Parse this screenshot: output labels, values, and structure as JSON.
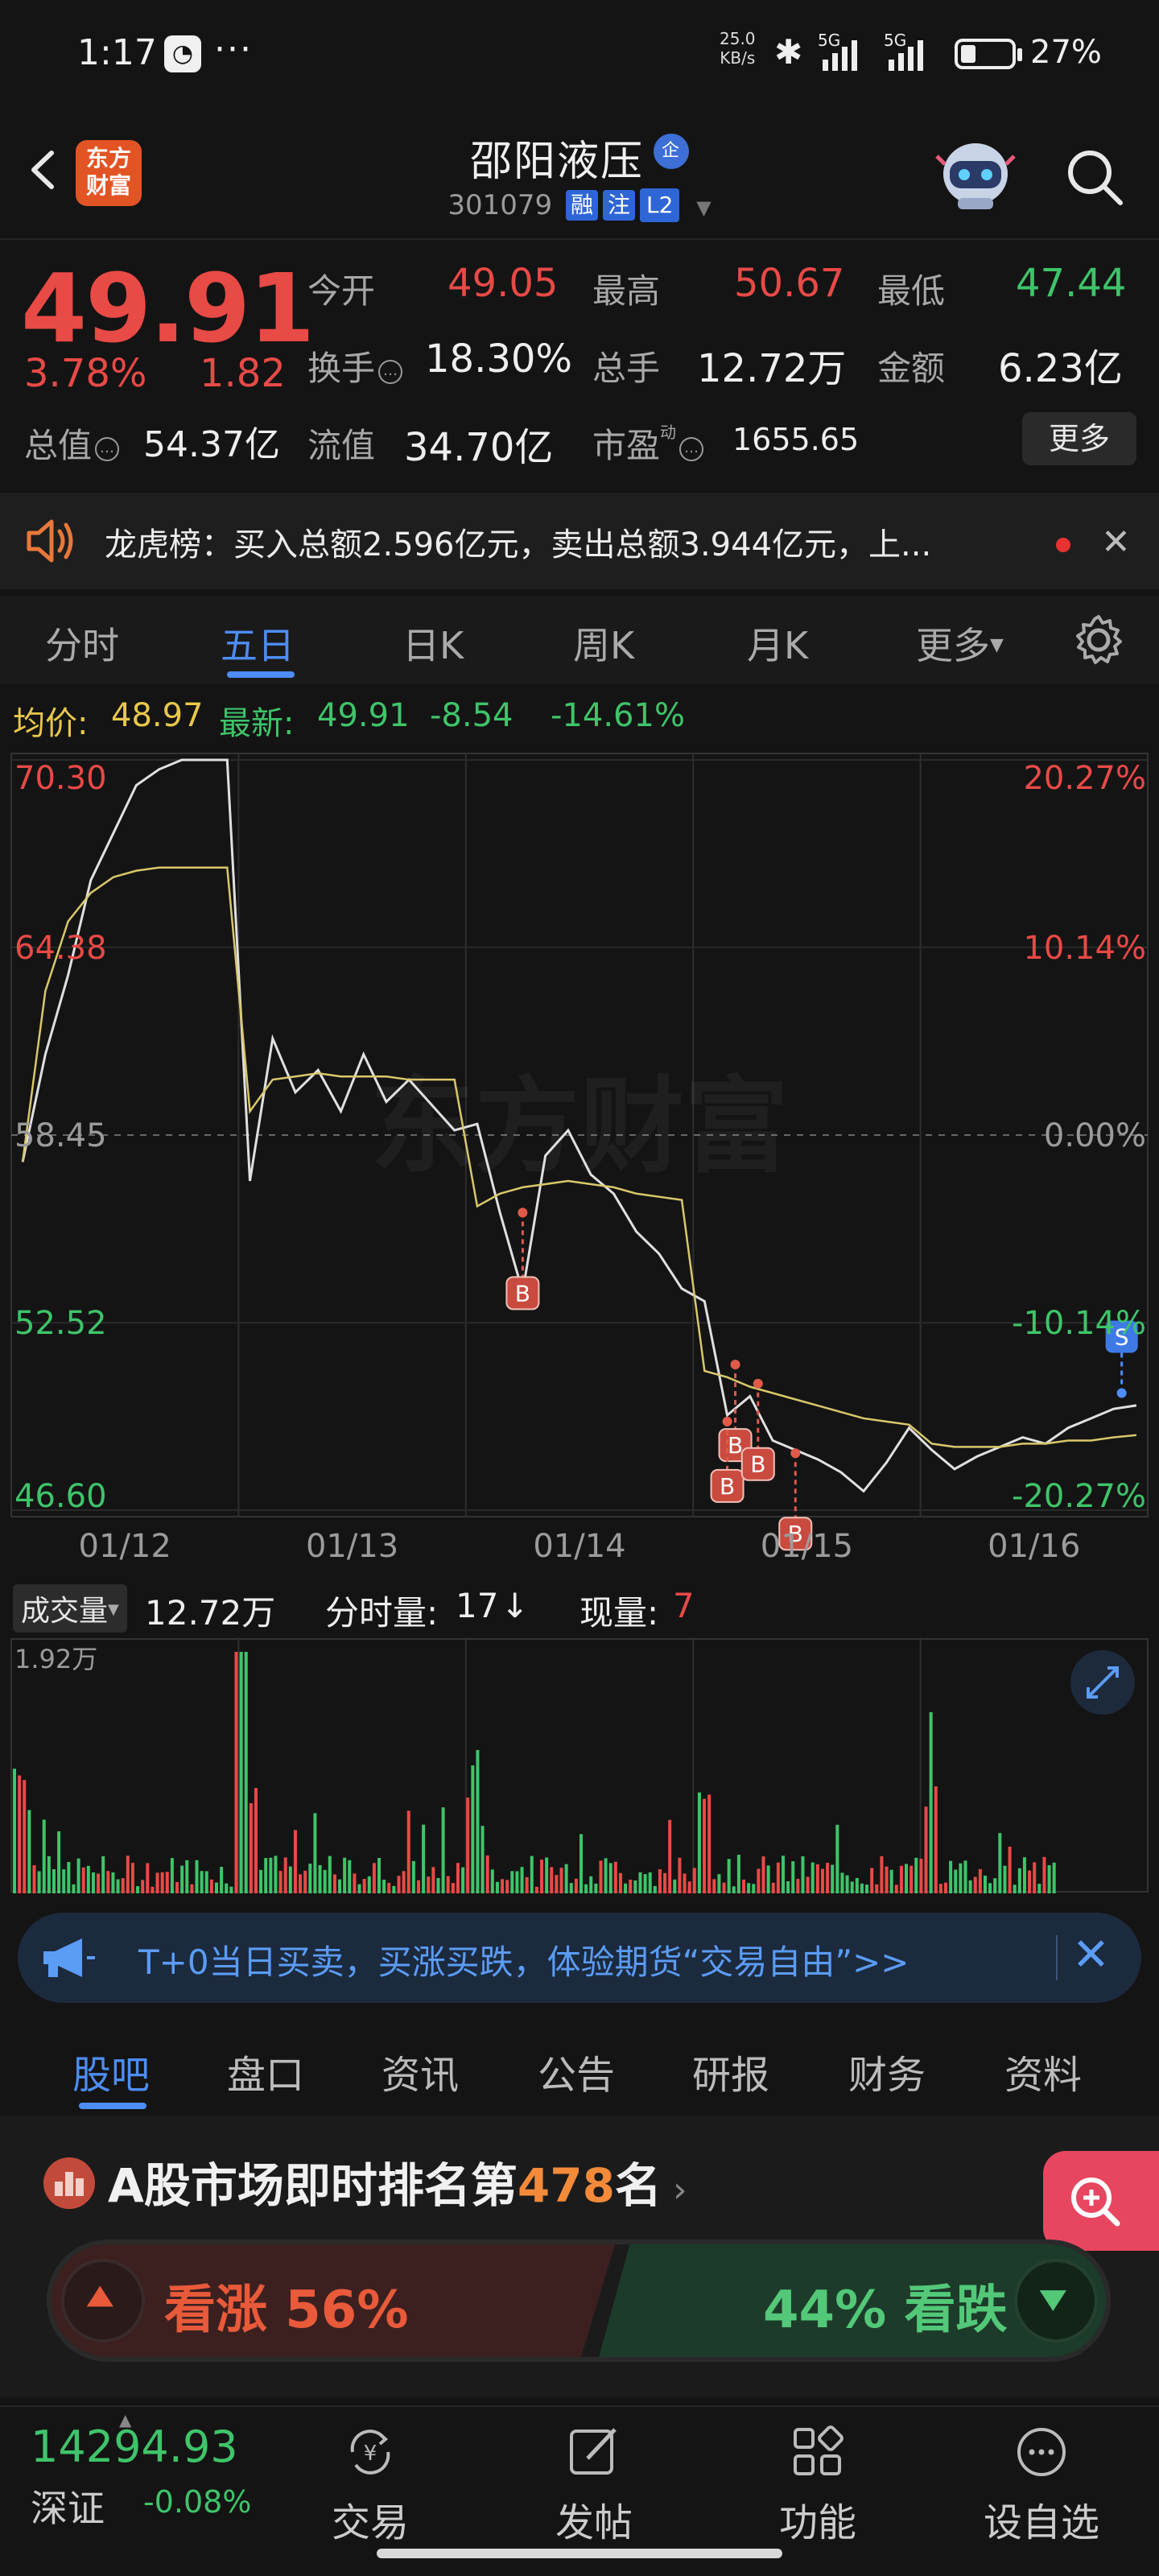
{
  "status": {
    "time": "1:17",
    "dots": "···",
    "net_speed": "25.0",
    "net_unit": "KB/s",
    "sig1": "5G",
    "sig2": "5G",
    "battery": "27%"
  },
  "header": {
    "logo_line1": "东方",
    "logo_line2": "财富",
    "name": "邵阳液压",
    "ent_badge": "企",
    "code": "301079",
    "tags": [
      "融",
      "注",
      "L2"
    ]
  },
  "quote": {
    "price": "49.91",
    "change_pct": "3.78%",
    "change_amt": "1.82",
    "open_label": "今开",
    "open": "49.05",
    "high_label": "最高",
    "high": "50.67",
    "low_label": "最低",
    "low": "47.44",
    "turnover_label": "换手",
    "turnover": "18.30%",
    "volume_label": "总手",
    "volume": "12.72万",
    "amount_label": "金额",
    "amount": "6.23亿",
    "mktcap_label": "总值",
    "mktcap": "54.37亿",
    "float_label": "流值",
    "float": "34.70亿",
    "pe_label": "市盈",
    "pe_sup": "动",
    "pe": "1655.65",
    "more": "更多"
  },
  "banner": {
    "text": "龙虎榜：买入总额2.596亿元，卖出总额3.944亿元，上..."
  },
  "tabs": [
    "分时",
    "五日",
    "日K",
    "周K",
    "月K",
    "更多"
  ],
  "active_tab": "五日",
  "chart_header": {
    "avg_label": "均价:",
    "avg": "48.97",
    "last_label": "最新:",
    "last": "49.91",
    "chg": "-8.54",
    "chg_pct": "-14.61%"
  },
  "chart_data": {
    "type": "line",
    "title": "",
    "y_left_ticks": [
      "70.30",
      "64.38",
      "58.45",
      "52.52",
      "46.60"
    ],
    "y_right_ticks": [
      "20.27%",
      "10.14%",
      "0.00%",
      "-10.14%",
      "-20.27%"
    ],
    "x_ticks": [
      "01/12",
      "01/13",
      "01/14",
      "01/15",
      "01/16"
    ],
    "ylim": [
      46.6,
      70.3
    ],
    "baseline": 58.45,
    "watermark": "东方财富",
    "series": [
      {
        "name": "price",
        "color": "#e0e0e0",
        "values": [
          57.6,
          61.0,
          63.5,
          66.5,
          68.0,
          69.5,
          70.0,
          70.3,
          70.3,
          70.3,
          57.0,
          61.5,
          59.8,
          60.5,
          59.2,
          61.0,
          59.5,
          60.2,
          59.4,
          58.6,
          58.8,
          56.0,
          53.5,
          57.8,
          58.6,
          57.2,
          56.6,
          55.4,
          54.7,
          53.6,
          53.2,
          49.6,
          50.2,
          48.8,
          48.5,
          48.2,
          47.8,
          47.2,
          48.1,
          49.2,
          48.5,
          47.9,
          48.3,
          48.6,
          48.9,
          48.7,
          49.2,
          49.5,
          49.8,
          49.91
        ]
      },
      {
        "name": "average",
        "color": "#d8c86a",
        "values": [
          57.6,
          63.0,
          65.2,
          66.1,
          66.6,
          66.8,
          66.9,
          66.9,
          66.9,
          66.9,
          59.2,
          60.2,
          60.3,
          60.4,
          60.3,
          60.3,
          60.3,
          60.2,
          60.2,
          60.2,
          56.2,
          56.6,
          56.8,
          56.9,
          57.0,
          56.9,
          56.8,
          56.6,
          56.5,
          56.4,
          51.0,
          50.8,
          50.5,
          50.3,
          50.1,
          49.9,
          49.7,
          49.5,
          49.4,
          49.3,
          48.7,
          48.6,
          48.6,
          48.6,
          48.7,
          48.7,
          48.8,
          48.8,
          48.9,
          48.97
        ]
      }
    ],
    "markers": [
      {
        "label": "B",
        "x_index": 22,
        "price": 56.0
      },
      {
        "label": "B",
        "x_index": 31,
        "price": 51.2
      },
      {
        "label": "B",
        "x_index": 31,
        "price": 49.4
      },
      {
        "label": "B",
        "x_index": 32,
        "price": 50.6
      },
      {
        "label": "B",
        "x_index": 34,
        "price": 48.4
      },
      {
        "label": "S",
        "x_index": 48,
        "price": 50.3
      }
    ]
  },
  "volume": {
    "label": "成交量",
    "total": "12.72万",
    "tick_label": "分时量:",
    "tick_val": "17",
    "tick_arrow": "↓",
    "now_label": "现量:",
    "now_val": "7",
    "max_label": "1.92万"
  },
  "futures_banner": {
    "text": "T+0当日买卖，买涨买跌，体验期货“交易自由”>>"
  },
  "bottom_tabs": [
    "股吧",
    "盘口",
    "资讯",
    "公告",
    "研报",
    "财务",
    "资料"
  ],
  "active_bottom_tab": "股吧",
  "rank": {
    "prefix": "A股市场即时排名第",
    "num": "478",
    "suffix": "名",
    "chev": "›"
  },
  "vote": {
    "bull": "看涨 56%",
    "bear": "44% 看跌"
  },
  "nav": {
    "index_value": "14294.93",
    "index_name": "深证",
    "index_change": "-0.08%",
    "items": [
      "交易",
      "发帖",
      "功能",
      "设自选"
    ]
  }
}
